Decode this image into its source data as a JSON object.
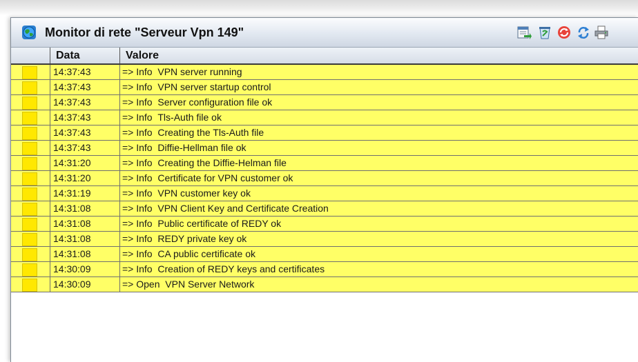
{
  "window": {
    "title": "Monitor di rete \"Serveur Vpn 149\"",
    "app_icon": "network-globe-icon"
  },
  "toolbar": {
    "buttons": [
      {
        "name": "export-icon"
      },
      {
        "name": "clear-log-icon"
      },
      {
        "name": "stop-refresh-icon"
      },
      {
        "name": "refresh-icon"
      },
      {
        "name": "print-icon"
      }
    ]
  },
  "colors": {
    "row_background": "#ffff66",
    "status_swatch": "#ffe800",
    "header_text": "#111111"
  },
  "table": {
    "columns": [
      "",
      "Data",
      "Valore"
    ],
    "rows": [
      {
        "time": "14:37:43",
        "message": "=> Info  VPN server running"
      },
      {
        "time": "14:37:43",
        "message": "=> Info  VPN server startup control"
      },
      {
        "time": "14:37:43",
        "message": "=> Info  Server configuration file ok"
      },
      {
        "time": "14:37:43",
        "message": "=> Info  Tls-Auth file ok"
      },
      {
        "time": "14:37:43",
        "message": "=> Info  Creating the Tls-Auth file"
      },
      {
        "time": "14:37:43",
        "message": "=> Info  Diffie-Hellman file ok"
      },
      {
        "time": "14:31:20",
        "message": "=> Info  Creating the Diffie-Helman file"
      },
      {
        "time": "14:31:20",
        "message": "=> Info  Certificate for VPN customer ok"
      },
      {
        "time": "14:31:19",
        "message": "=> Info  VPN customer key ok"
      },
      {
        "time": "14:31:08",
        "message": "=> Info  VPN Client Key and Certificate Creation"
      },
      {
        "time": "14:31:08",
        "message": "=> Info  Public certificate of REDY ok"
      },
      {
        "time": "14:31:08",
        "message": "=> Info  REDY private key ok"
      },
      {
        "time": "14:31:08",
        "message": "=> Info  CA public certificate ok"
      },
      {
        "time": "14:30:09",
        "message": "=> Info  Creation of REDY keys and certificates"
      },
      {
        "time": "14:30:09",
        "message": "=> Open  VPN Server Network"
      }
    ]
  }
}
